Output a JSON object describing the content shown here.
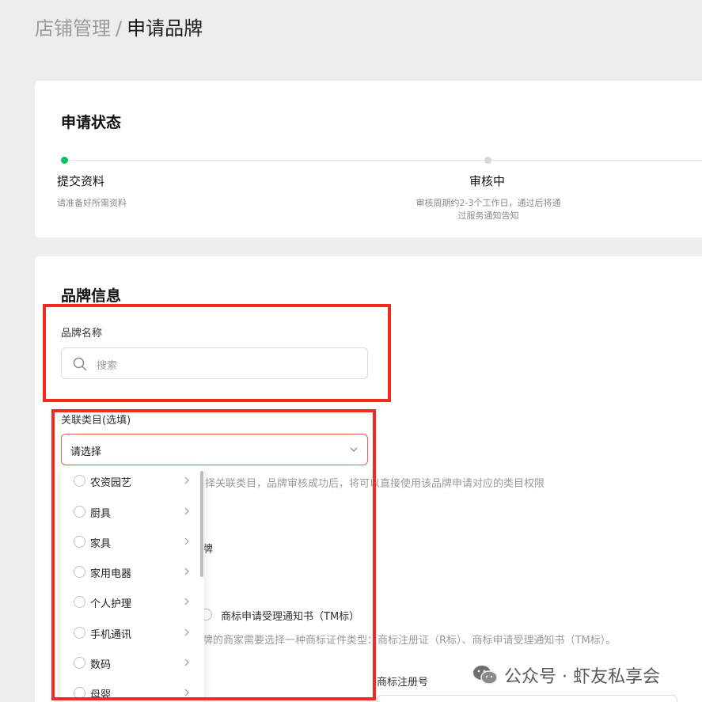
{
  "breadcrumb": {
    "parent": "店铺管理",
    "separator": "/",
    "current": "申请品牌"
  },
  "status_card": {
    "title": "申请状态",
    "steps": [
      {
        "title": "提交资料",
        "description": "请准备好所需资料",
        "state": "active"
      },
      {
        "title": "审核中",
        "description_line1": "审核周期约2-3个工作日，通过后将通",
        "description_line2": "过服务通知告知",
        "state": "pending"
      }
    ],
    "active_color": "#07c160"
  },
  "brand_card": {
    "title": "品牌信息",
    "brand_name": {
      "label": "品牌名称",
      "placeholder": "搜索"
    },
    "category": {
      "label": "关联类目(选填)",
      "value": "请选择",
      "hint": "择关联类目，品牌审核成功后，将可以直接使用该品牌申请对应的类目权限"
    },
    "partial_label": "牌",
    "trademark_option": "商标申请受理通知书（TM标）",
    "trademark_hint": "牌的商家需要选择一种商标证件类型：商标注册证（R标）、商标申请受理通知书（TM标）。",
    "reg_no_label": "商标注册号"
  },
  "category_dropdown": {
    "items": [
      {
        "label": "农资园艺"
      },
      {
        "label": "厨具"
      },
      {
        "label": "家具"
      },
      {
        "label": "家用电器"
      },
      {
        "label": "个人护理"
      },
      {
        "label": "手机通讯"
      },
      {
        "label": "数码"
      },
      {
        "label": "母婴"
      }
    ]
  },
  "highlight_color": "#f22a20",
  "watermark": {
    "text": "公众号 · 虾友私享会"
  }
}
